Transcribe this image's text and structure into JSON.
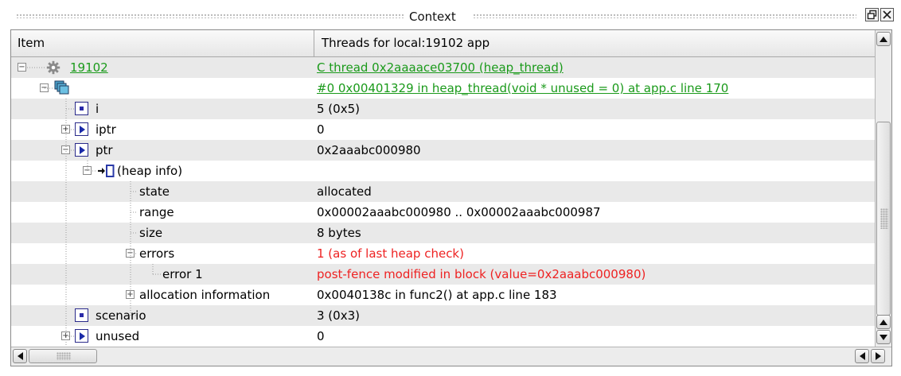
{
  "panel": {
    "title": "Context"
  },
  "header": {
    "col_item": "Item",
    "col_threads": "Threads for local:19102 app"
  },
  "rows": [
    {
      "item": "19102",
      "value": "C thread 0x2aaaace03700 (heap_thread)",
      "style": "link"
    },
    {
      "item": "",
      "value": "#0 0x00401329 in heap_thread(void * unused = 0) at app.c line 170",
      "style": "link"
    },
    {
      "item": "i",
      "value": "5 (0x5)",
      "style": "normal"
    },
    {
      "item": "iptr",
      "value": "0",
      "style": "normal"
    },
    {
      "item": "ptr",
      "value": "0x2aaabc000980",
      "style": "normal"
    },
    {
      "item": "(heap info)",
      "value": "",
      "style": "normal"
    },
    {
      "item": "state",
      "value": "allocated",
      "style": "normal"
    },
    {
      "item": "range",
      "value": "0x00002aaabc000980 .. 0x00002aaabc000987",
      "style": "normal"
    },
    {
      "item": "size",
      "value": "8 bytes",
      "style": "normal"
    },
    {
      "item": "errors",
      "value": "1 (as of last heap check)",
      "style": "error"
    },
    {
      "item": "error 1",
      "value": "post-fence modified in block (value=0x2aaabc000980)",
      "style": "error"
    },
    {
      "item": "allocation information",
      "value": "0x0040138c in func2() at app.c line 183",
      "style": "normal"
    },
    {
      "item": "scenario",
      "value": "3 (0x3)",
      "style": "normal"
    },
    {
      "item": "unused",
      "value": "0",
      "style": "normal"
    }
  ],
  "colors": {
    "link": "#1a9a1a",
    "error": "#ee2222",
    "row_alt": "#e9e9e9"
  },
  "icons": {
    "process": "gear-icon",
    "frame": "stack-frames-icon",
    "scalar": "scalar-variable-icon",
    "pointer": "pointer-variable-icon",
    "heap": "heap-info-icon"
  }
}
